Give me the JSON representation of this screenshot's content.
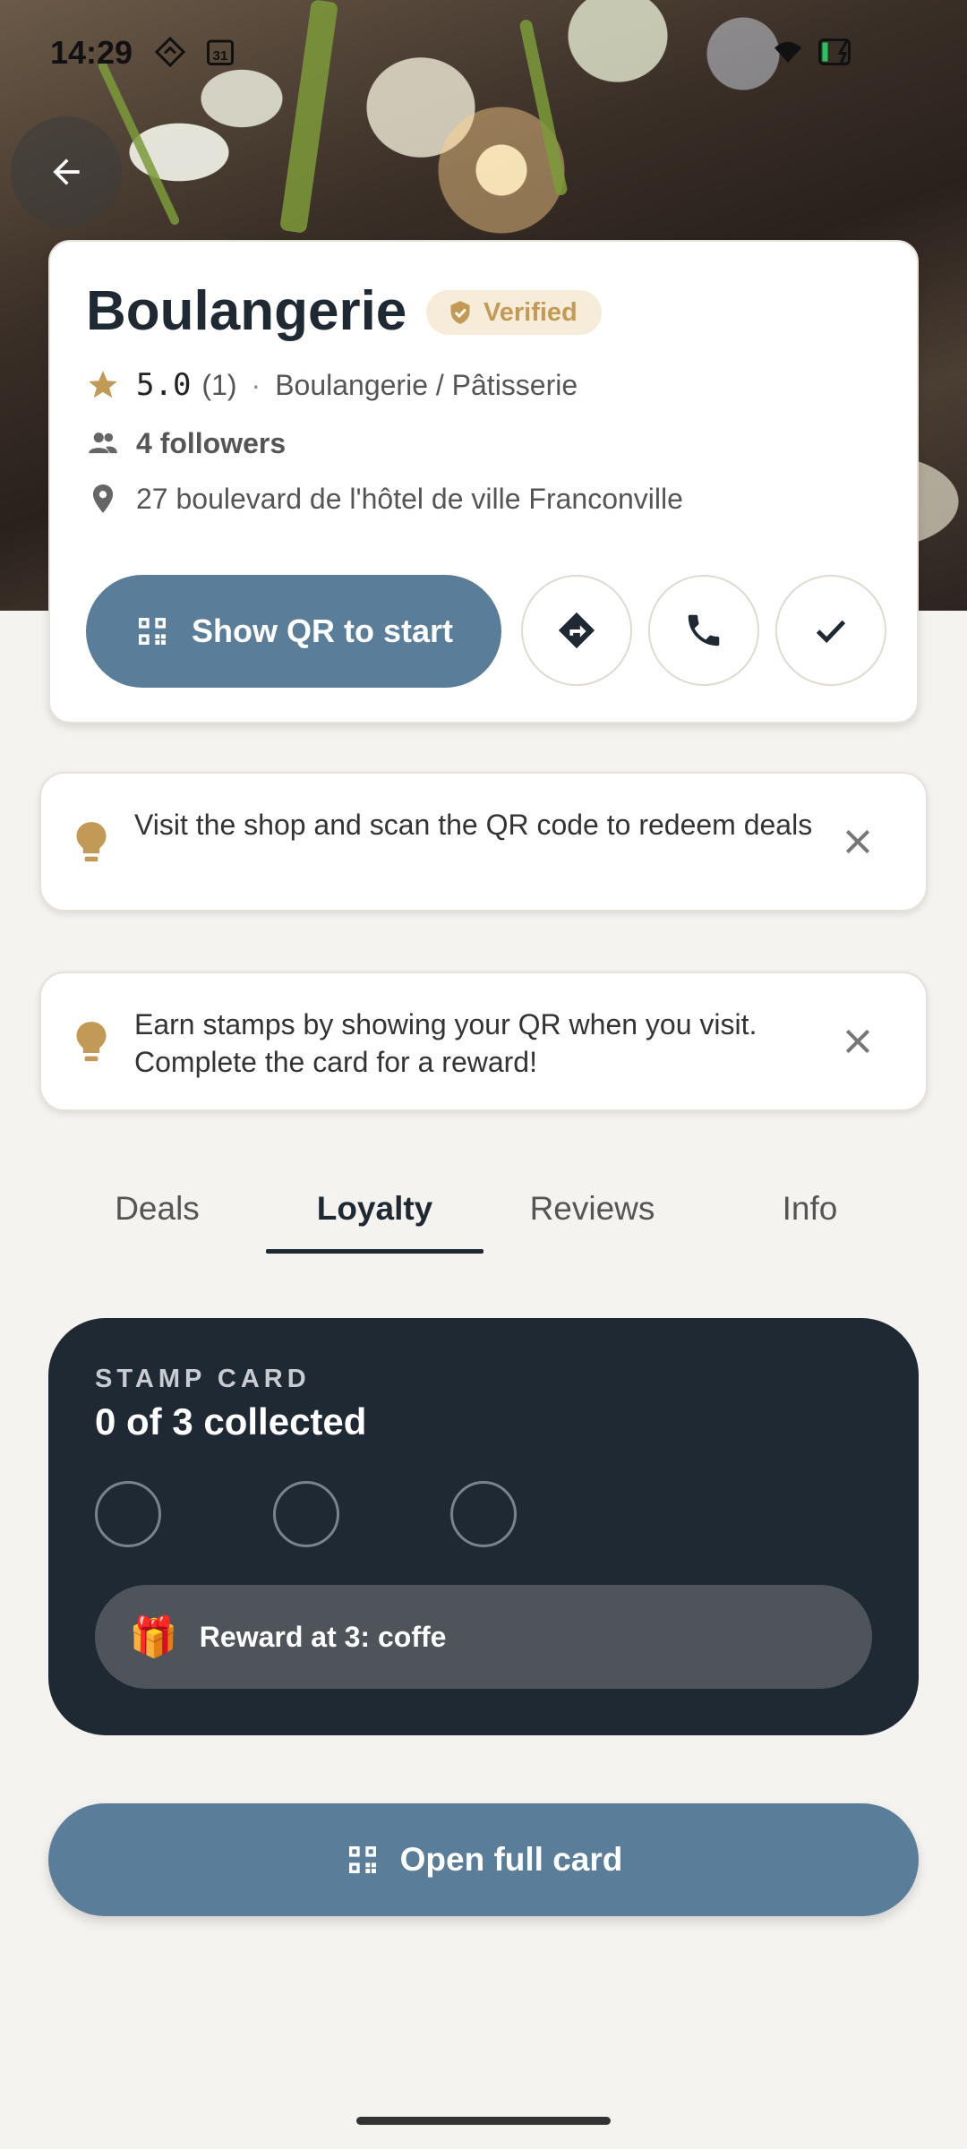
{
  "status_bar": {
    "time": "14:29",
    "calendar_day": "31"
  },
  "header": {
    "title": "Boulangerie",
    "verified_label": "Verified",
    "rating": "5.0",
    "rating_count": "(1)",
    "separator": "·",
    "category": "Boulangerie / Pâtisserie",
    "followers": "4 followers",
    "address": "27 boulevard de l'hôtel de ville Franconville",
    "qr_button_label": "Show QR to start"
  },
  "tips": [
    {
      "text": "Visit the shop and scan the QR code to redeem deals"
    },
    {
      "text": "Earn stamps by showing your QR when you visit. Complete the card for a reward!"
    }
  ],
  "tabs": [
    {
      "label": "Deals",
      "active": false
    },
    {
      "label": "Loyalty",
      "active": true
    },
    {
      "label": "Reviews",
      "active": false
    },
    {
      "label": "Info",
      "active": false
    }
  ],
  "stamp_card": {
    "label": "STAMP CARD",
    "collected_text": "0 of 3 collected",
    "collected": 0,
    "total": 3,
    "reward_icon": "🎁",
    "reward_text": "Reward at 3: coffe"
  },
  "open_card_label": "Open full card",
  "colors": {
    "primary": "#5a7d99",
    "dark_card": "#1f2933",
    "accent_gold": "#c29a55",
    "background": "#f5f3ef"
  },
  "icons": [
    "back-arrow-icon",
    "verified-badge-icon",
    "star-icon",
    "people-icon",
    "location-pin-icon",
    "qr-code-icon",
    "directions-icon",
    "phone-icon",
    "check-icon",
    "lightbulb-icon",
    "close-icon",
    "gift-icon"
  ]
}
